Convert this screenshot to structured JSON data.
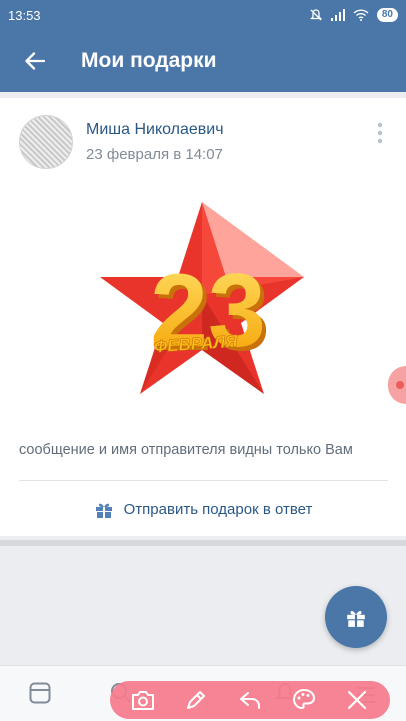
{
  "status_bar": {
    "time": "13:53",
    "battery": "80"
  },
  "app_bar": {
    "title": "Мои подарки",
    "back_icon": "arrow-left-icon"
  },
  "gift_card": {
    "sender_name": "Миша Николаевич",
    "date": "23 февраля в 14:07",
    "image": {
      "number": "23",
      "caption": "ФЕВРАЛЯ"
    },
    "privacy_note": "сообщение и имя отправителя видны только Вам",
    "reply_label": "Отправить подарок в ответ"
  },
  "colors": {
    "header": "#4a76a8",
    "link": "#2a5885",
    "secondary_text": "#818c99",
    "star_red": "#e8342b",
    "number_yellow": "#ffc21a",
    "toolbar_pink": "#f57b8c"
  },
  "bottom_nav": {
    "icons": [
      "newsfeed-icon",
      "search-icon",
      "notifications-icon",
      "menu-icon"
    ]
  },
  "overlay_toolbar": {
    "icons": [
      "camera-icon",
      "pen-icon",
      "undo-icon",
      "palette-icon",
      "close-icon"
    ]
  }
}
